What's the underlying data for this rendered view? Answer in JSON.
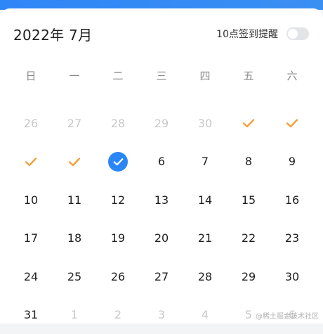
{
  "header": {
    "month_title": "2022年 7月",
    "remind_label": "10点签到提醒",
    "remind_enabled": false
  },
  "weekdays": [
    "日",
    "一",
    "二",
    "三",
    "四",
    "五",
    "六"
  ],
  "days": [
    {
      "label": "26",
      "state": "muted"
    },
    {
      "label": "27",
      "state": "muted"
    },
    {
      "label": "28",
      "state": "muted"
    },
    {
      "label": "29",
      "state": "muted"
    },
    {
      "label": "30",
      "state": "muted"
    },
    {
      "label": "",
      "state": "checked"
    },
    {
      "label": "",
      "state": "checked"
    },
    {
      "label": "",
      "state": "checked"
    },
    {
      "label": "",
      "state": "checked"
    },
    {
      "label": "",
      "state": "selected"
    },
    {
      "label": "6",
      "state": "normal"
    },
    {
      "label": "7",
      "state": "normal"
    },
    {
      "label": "8",
      "state": "normal"
    },
    {
      "label": "9",
      "state": "normal"
    },
    {
      "label": "10",
      "state": "normal"
    },
    {
      "label": "11",
      "state": "normal"
    },
    {
      "label": "12",
      "state": "normal"
    },
    {
      "label": "13",
      "state": "normal"
    },
    {
      "label": "14",
      "state": "normal"
    },
    {
      "label": "15",
      "state": "normal"
    },
    {
      "label": "16",
      "state": "normal"
    },
    {
      "label": "17",
      "state": "normal"
    },
    {
      "label": "18",
      "state": "normal"
    },
    {
      "label": "19",
      "state": "normal"
    },
    {
      "label": "20",
      "state": "normal"
    },
    {
      "label": "21",
      "state": "normal"
    },
    {
      "label": "22",
      "state": "normal"
    },
    {
      "label": "23",
      "state": "normal"
    },
    {
      "label": "24",
      "state": "normal"
    },
    {
      "label": "25",
      "state": "normal"
    },
    {
      "label": "26",
      "state": "normal"
    },
    {
      "label": "27",
      "state": "normal"
    },
    {
      "label": "28",
      "state": "normal"
    },
    {
      "label": "29",
      "state": "normal"
    },
    {
      "label": "30",
      "state": "normal"
    },
    {
      "label": "31",
      "state": "normal"
    },
    {
      "label": "1",
      "state": "muted"
    },
    {
      "label": "2",
      "state": "muted"
    },
    {
      "label": "3",
      "state": "muted"
    },
    {
      "label": "4",
      "state": "muted"
    },
    {
      "label": "5",
      "state": "muted"
    },
    {
      "label": "6",
      "state": "muted"
    }
  ],
  "icons": {
    "checked": "checkmark-icon",
    "selected": "selected-check-icon"
  },
  "colors": {
    "accent": "#2b86f5",
    "check": "#f5a03a",
    "muted_text": "#c8c8c8"
  },
  "watermark": "@稀土掘金技术社区"
}
